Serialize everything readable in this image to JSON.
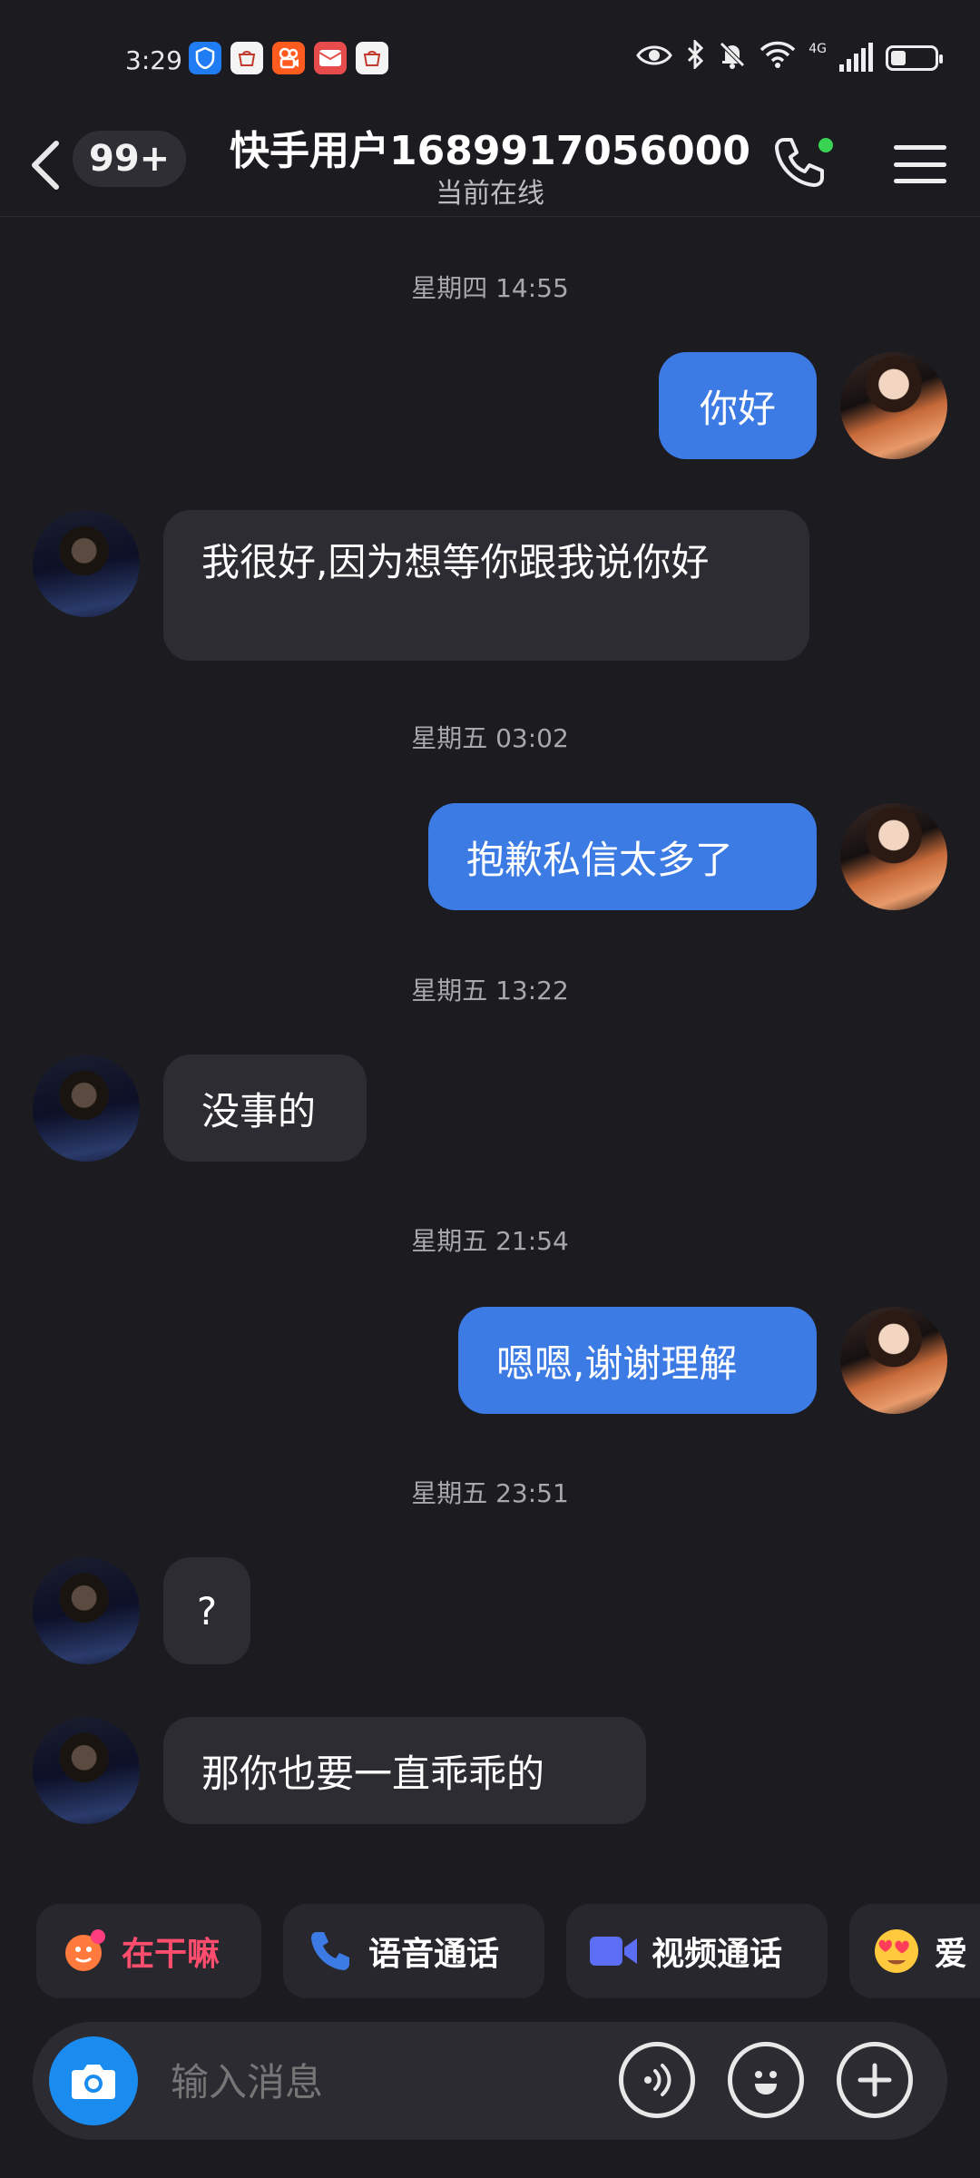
{
  "status_bar": {
    "time": "3:29",
    "network": "4G",
    "app_icons": [
      "shield-icon",
      "huawei-store-icon",
      "kuaishou-icon",
      "mail-icon",
      "huawei-store-icon"
    ],
    "battery_level": 0.35
  },
  "header": {
    "back_label": "‹",
    "unread_count": "99+",
    "title": "快手用户1689917056000",
    "subtitle": "当前在线",
    "call_status_color": "#39d353"
  },
  "messages": [
    {
      "type": "time",
      "text": "星期四 14:55"
    },
    {
      "type": "out",
      "text": "你好"
    },
    {
      "type": "in",
      "text": "我很好,因为想等你跟我说你好"
    },
    {
      "type": "time",
      "text": "星期五 03:02"
    },
    {
      "type": "out",
      "text": "抱歉私信太多了"
    },
    {
      "type": "time",
      "text": "星期五 13:22"
    },
    {
      "type": "in",
      "text": "没事的"
    },
    {
      "type": "time",
      "text": "星期五 21:54"
    },
    {
      "type": "out",
      "text": "嗯嗯,谢谢理解"
    },
    {
      "type": "time",
      "text": "星期五 23:51"
    },
    {
      "type": "in",
      "text": "?"
    },
    {
      "type": "in",
      "text": "那你也要一直乖乖的"
    }
  ],
  "quick_actions": [
    {
      "label": "在干嘛",
      "icon": "wave-hand-icon",
      "color": "#ff4d6d"
    },
    {
      "label": "语音通话",
      "icon": "phone-icon",
      "color": "#ffffff"
    },
    {
      "label": "视频通话",
      "icon": "video-icon",
      "color": "#ffffff"
    },
    {
      "label": "爱",
      "icon": "heart-eyes-emoji-icon",
      "color": "#ffffff"
    }
  ],
  "input": {
    "placeholder": "输入消息"
  },
  "colors": {
    "background": "#1b1b20",
    "outgoing_bubble": "#3c7ae4",
    "incoming_bubble": "#2c2c32",
    "camera_button": "#1a8cf0"
  }
}
